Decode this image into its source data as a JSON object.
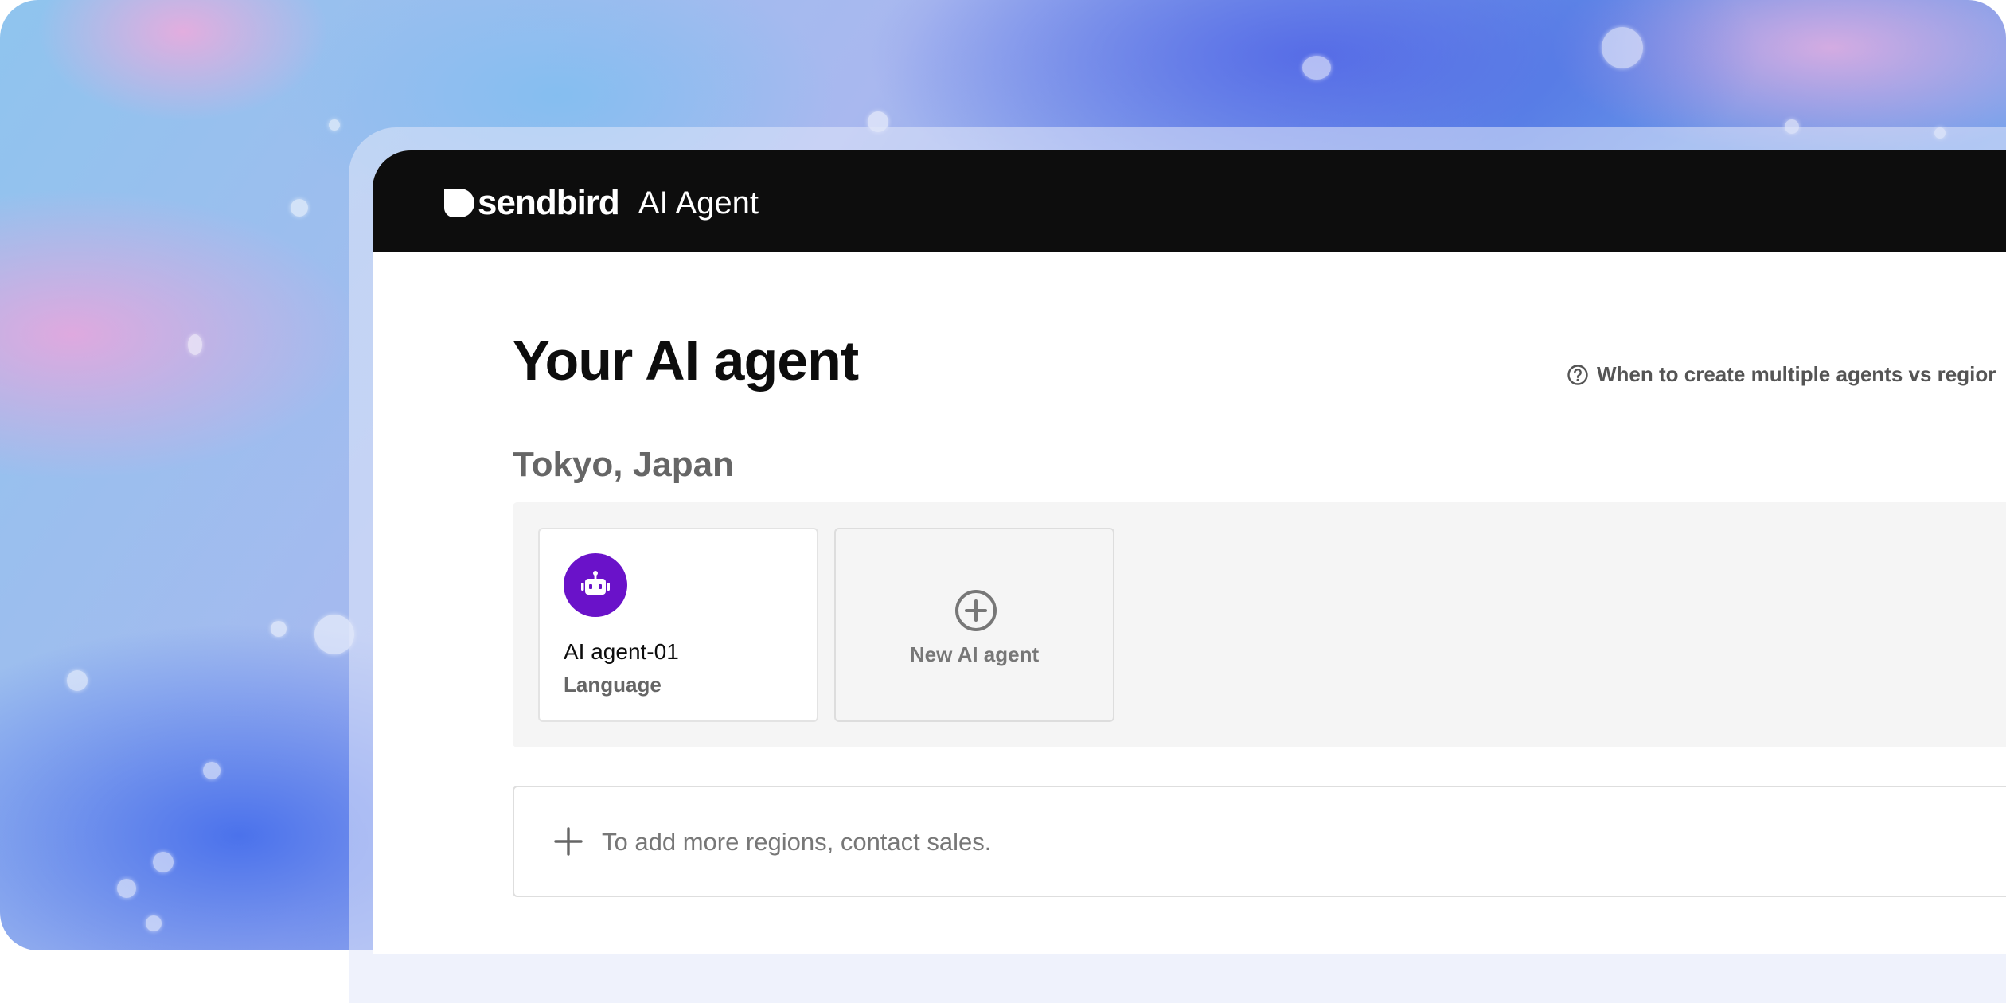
{
  "app": {
    "brand": "sendbird",
    "product": "AI Agent"
  },
  "page": {
    "title": "Your AI agent",
    "help_link": "When to create multiple agents vs regior"
  },
  "region": {
    "name": "Tokyo, Japan",
    "agents": [
      {
        "name": "AI agent-01",
        "subtitle": "Language",
        "icon": "robot-icon",
        "avatar_color": "#6a12c9"
      }
    ],
    "new_agent_label": "New AI agent"
  },
  "add_regions": {
    "text": "To add more regions, contact sales."
  },
  "colors": {
    "topbar": "#0d0d0d",
    "accent": "#6a12c9"
  }
}
